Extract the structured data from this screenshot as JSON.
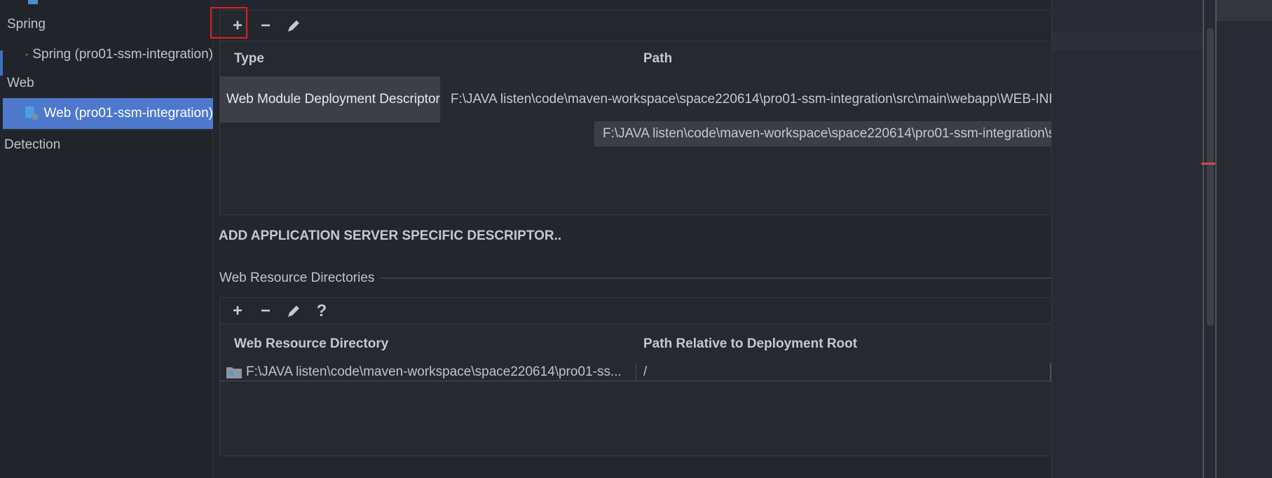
{
  "sidebar": {
    "groups": [
      {
        "label": "Spring"
      },
      {
        "label": "Web"
      },
      {
        "label": "Detection"
      }
    ],
    "items": [
      {
        "label": "Spring (pro01-ssm-integration)",
        "icon": "spring-leaf-icon"
      },
      {
        "label": "Web (pro01-ssm-integration)",
        "icon": "web-module-icon",
        "selected": true
      }
    ]
  },
  "descriptors": {
    "toolbar": [
      "add",
      "remove",
      "edit"
    ],
    "columns": [
      "Type",
      "Path"
    ],
    "rows": [
      {
        "type": "Web Module Deployment Descriptor",
        "path": "F:\\JAVA listen\\code\\maven-workspace\\space220614\\pro01-ssm-integration\\src\\main\\webapp\\WEB-INF\\web.xml"
      }
    ],
    "tooltip": "F:\\JAVA listen\\code\\maven-workspace\\space220614\\pro01-ssm-integration\\src\\main\\webapp\\WEB-INF\\web.xml"
  },
  "add_server_descriptor": "ADD APPLICATION SERVER SPECIFIC DESCRIPTOR..",
  "resources": {
    "title": "Web Resource Directories",
    "toolbar": [
      "add",
      "remove",
      "edit",
      "help"
    ],
    "columns": [
      "Web Resource Directory",
      "Path Relative to Deployment Root"
    ],
    "rows": [
      {
        "directory": "F:\\JAVA listen\\code\\maven-workspace\\space220614\\pro01-ss...",
        "relative": "/"
      }
    ]
  },
  "colors": {
    "selection": "#4d78cc",
    "highlight": "#e02020",
    "background": "#23262d"
  }
}
